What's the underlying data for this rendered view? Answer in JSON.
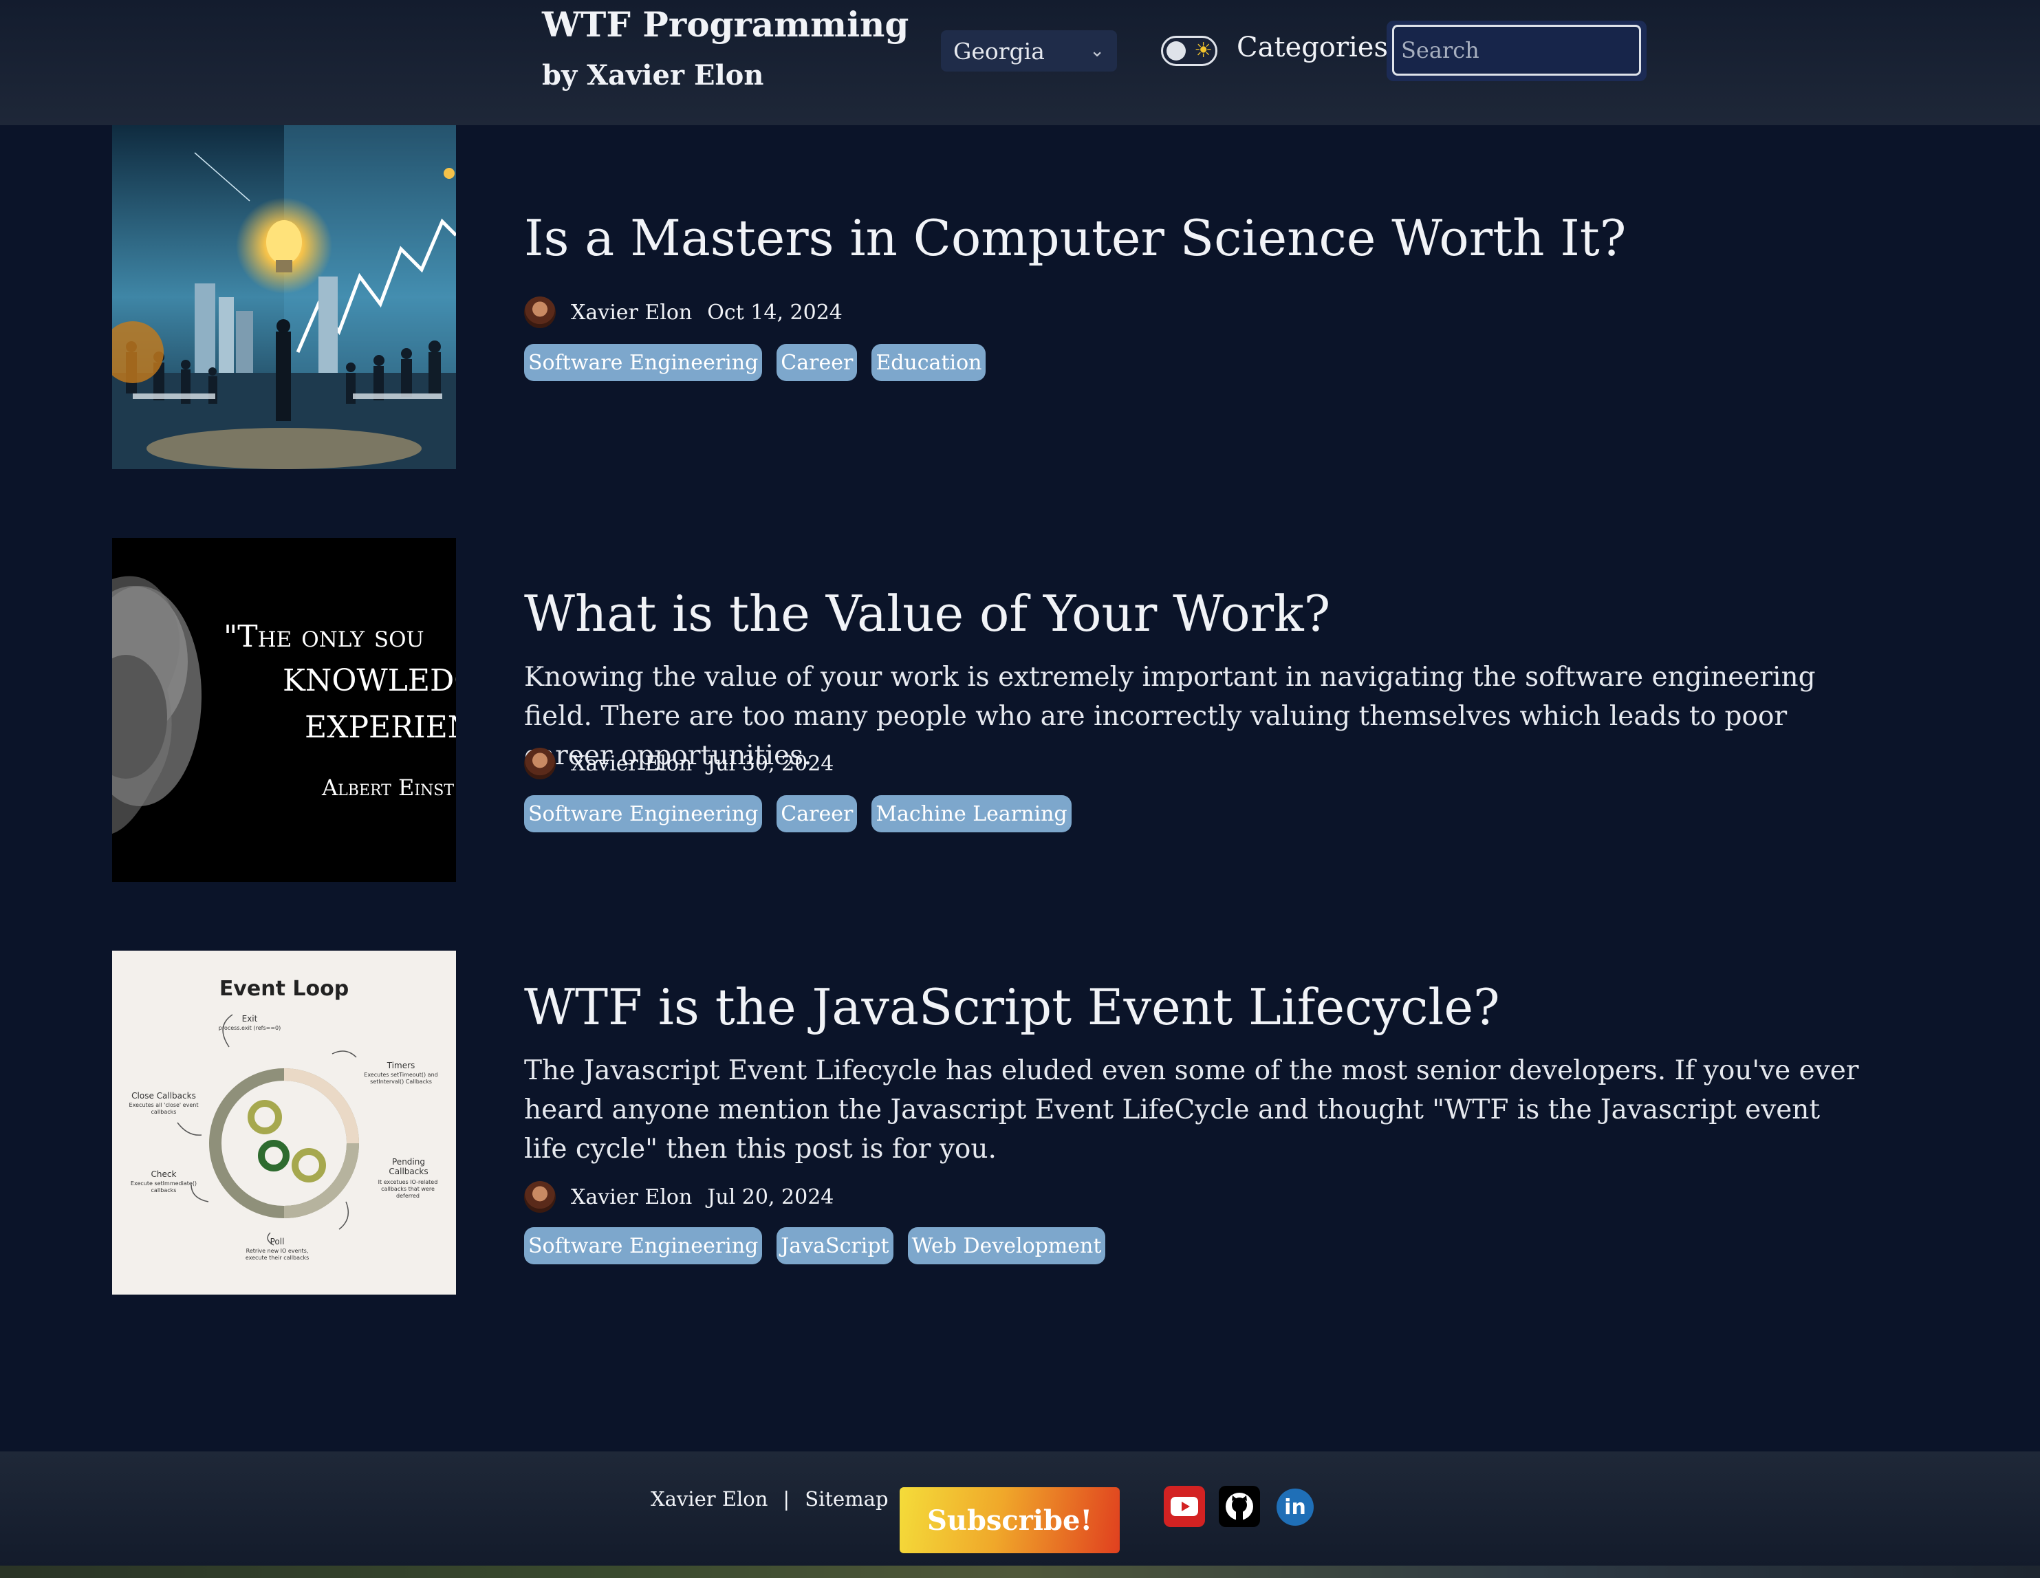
{
  "header": {
    "title": "WTF Programming",
    "subtitle": "by Xavier Elon",
    "font_select": {
      "value": "Georgia"
    },
    "categories_label": "Categories",
    "search": {
      "placeholder": "Search"
    }
  },
  "posts": [
    {
      "title": "Is a Masters in Computer Science Worth It?",
      "description": "",
      "author": "Xavier Elon",
      "date": "Oct 14, 2024",
      "tags": [
        "Software Engineering",
        "Career",
        "Education"
      ]
    },
    {
      "title": "What is the Value of Your Work?",
      "description": "Knowing the value of your work is extremely important in navigating the software engineering field. There are too many people who are incorrectly valuing themselves which leads to poor career opportunities.",
      "author": "Xavier Elon",
      "date": "Jul 30, 2024",
      "tags": [
        "Software Engineering",
        "Career",
        "Machine Learning"
      ],
      "image_text": {
        "line1": "\"The only sou",
        "line2": "knowledg",
        "line3": "experienc",
        "attribution": "Albert Einst"
      }
    },
    {
      "title": "WTF is the JavaScript Event Lifecycle?",
      "description": "The Javascript Event Lifecycle has eluded even some of the most senior developers. If you've ever heard anyone mention the Javascript Event LifeCycle and thought \"WTF is the Javascript event life cycle\" then this post is for you.",
      "author": "Xavier Elon",
      "date": "Jul 20, 2024",
      "tags": [
        "Software Engineering",
        "JavaScript",
        "Web Development"
      ],
      "image_text": {
        "heading": "Event Loop",
        "exit": "Exit",
        "exit_sub": "process.exit (refs==0)",
        "timers": "Timers",
        "timers_sub": "Executes setTimeout() and setInterval() Callbacks",
        "close": "Close Callbacks",
        "close_sub": "Executes all 'close' event callbacks",
        "pending": "Pending Callbacks",
        "pending_sub": "It excetues IO-related callbacks that were deferred",
        "check": "Check",
        "check_sub": "Execute setImmediate() callbacks",
        "poll": "Poll",
        "poll_sub": "Retrive new IO events, execute their callbacks"
      }
    }
  ],
  "footer": {
    "author_link": "Xavier Elon",
    "separator": "|",
    "sitemap_link": "Sitemap",
    "subscribe_label": "Subscribe!",
    "linkedin_text": "in"
  },
  "colors": {
    "background": "#0b1429",
    "tag": "#7da7cc",
    "header": "#1a2234"
  }
}
